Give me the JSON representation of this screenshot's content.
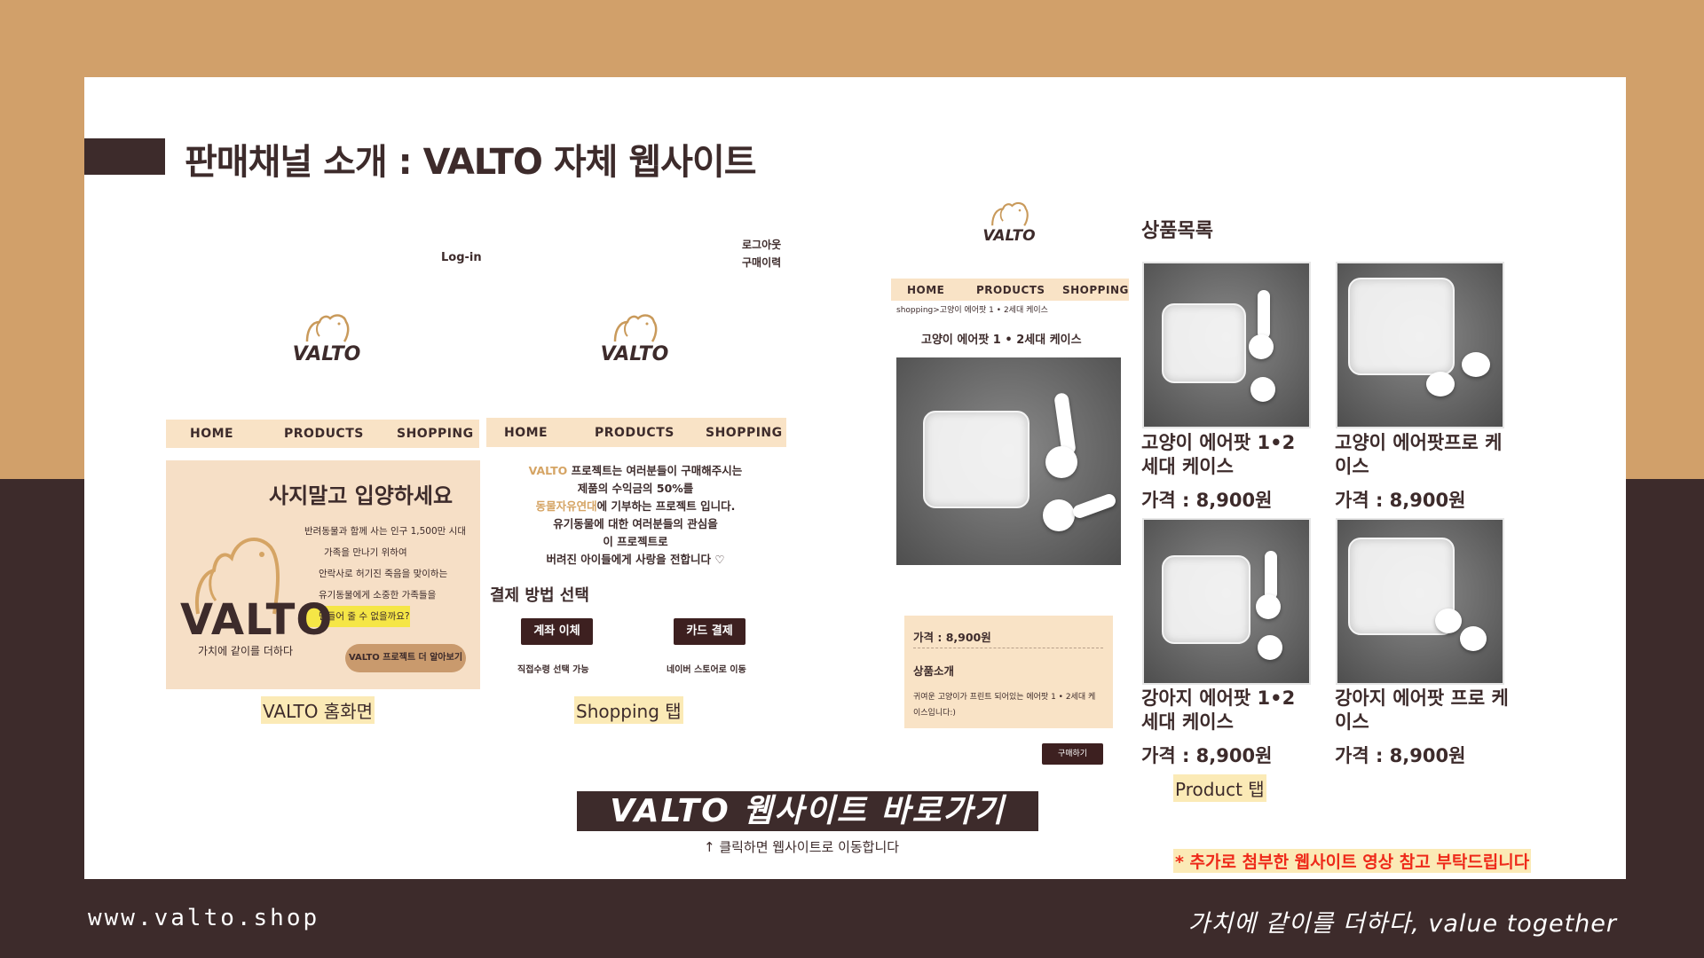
{
  "slide": {
    "title": "판매채널 소개 : VALTO 자체 웹사이트",
    "colors": {
      "brown_top": "#d1a06a",
      "dark_bottom": "#3d2b2b",
      "nav_bg": "#f9e3c6",
      "highlight": "#fbeab6",
      "notice_red": "#ee2a1a"
    }
  },
  "home_screen": {
    "login": "Log-in",
    "logo": "VALTO",
    "nav": [
      "HOME",
      "PRODUCTS",
      "SHOPPING"
    ],
    "banner": {
      "headline": "사지말고 입양하세요",
      "lines": [
        "반려동물과 함께 사는 인구 1,500만 시대",
        "가족을 만나기 위하여",
        "안락사로 허기진 죽음을 맞이하는",
        "유기동물에게 소중한 가족들을",
        "만들어 줄 수 없을까요?"
      ],
      "brand": "VALTO",
      "slogan": "가치에 같이를 더하다",
      "cta": "VALTO 프로젝트 더 알아보기"
    },
    "caption": "VALTO 홈화면"
  },
  "shopping_screen": {
    "top_links": [
      "로그아웃",
      "구매이력"
    ],
    "logo": "VALTO",
    "nav": [
      "HOME",
      "PRODUCTS",
      "SHOPPING"
    ],
    "intro_lines": [
      "프로젝트는 여러분들이 구매해주시는",
      "제품의 수익금의 50%를",
      "에 기부하는 프로젝트 입니다.",
      "유기동물에 대한 여러분들의 관심을",
      "이 프로젝트로",
      "버려진 아이들에게 사랑을 전합니다 ♡"
    ],
    "intro_brand": "VALTO",
    "intro_org": "동물자유연대",
    "payment_title": "결제 방법 선택",
    "pay_account": "계좌 이체",
    "pay_card": "카드 결제",
    "pay_account_note": "직접수령 선택 가능",
    "pay_card_note": "네이버 스토어로 이동",
    "caption": "Shopping 탭"
  },
  "detail_screen": {
    "logo": "VALTO",
    "nav": [
      "HOME",
      "PRODUCTS",
      "SHOPPING"
    ],
    "breadcrumb": "shopping>고양이 에어팟 1 • 2세대 케이스",
    "product_title": "고양이 에어팟 1 • 2세대 케이스",
    "price": "가격 : 8,900원",
    "intro_title": "상품소개",
    "intro_text": "귀여운 고양이가 프린트 되어있는 에어팟 1 • 2세대 케이스입니다:)",
    "buy": "구매하기"
  },
  "product_list": {
    "title": "상품목록",
    "items": [
      {
        "name": "고양이 에어팟 1•2 세대 케이스",
        "price": "가격 : 8,900원"
      },
      {
        "name": "고양이 에어팟프로 케이스",
        "price": "가격 : 8,900원"
      },
      {
        "name": "강아지 에어팟 1•2 세대 케이스",
        "price": "가격 : 8,900원"
      },
      {
        "name": "강아지 에어팟 프로 케이스",
        "price": "가격 : 8,900원"
      }
    ],
    "caption": "Product 탭"
  },
  "shortcut": {
    "label": "VALTO 웹사이트 바로가기",
    "hint": "↑ 클릭하면 웹사이트로 이동합니다"
  },
  "notice": "* 추가로 첨부한 웹사이트 영상 참고 부탁드립니다",
  "footer": {
    "url": "www.valto.shop",
    "tagline": "가치에 같이를 더하다, value together"
  }
}
